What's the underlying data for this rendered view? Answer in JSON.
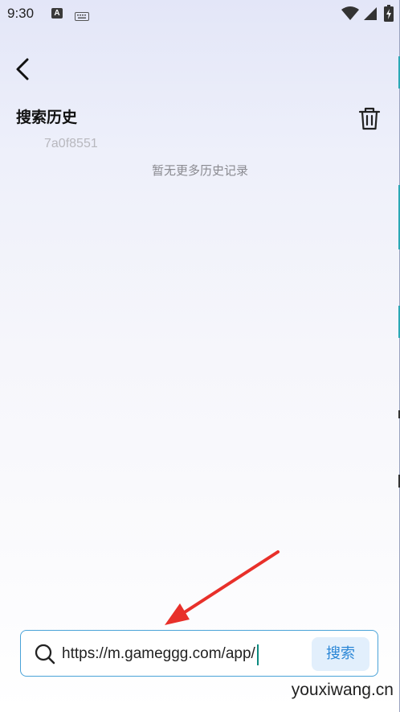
{
  "status_bar": {
    "time": "9:30",
    "notification_badge": "A"
  },
  "history": {
    "title": "搜索历史",
    "items": [
      "7a0f8551"
    ],
    "empty_text": "暂无更多历史记录"
  },
  "search": {
    "value": "https://m.gameggg.com/app/",
    "button_label": "搜索"
  },
  "watermark": "youxiwang.cn",
  "colors": {
    "accent": "#2a86d6",
    "input_border": "#4aa3d8",
    "arrow": "#e8302a"
  },
  "icons": [
    "back-arrow-icon",
    "trash-icon",
    "search-icon",
    "wifi-icon",
    "signal-icon",
    "battery-icon",
    "keyboard-icon"
  ]
}
